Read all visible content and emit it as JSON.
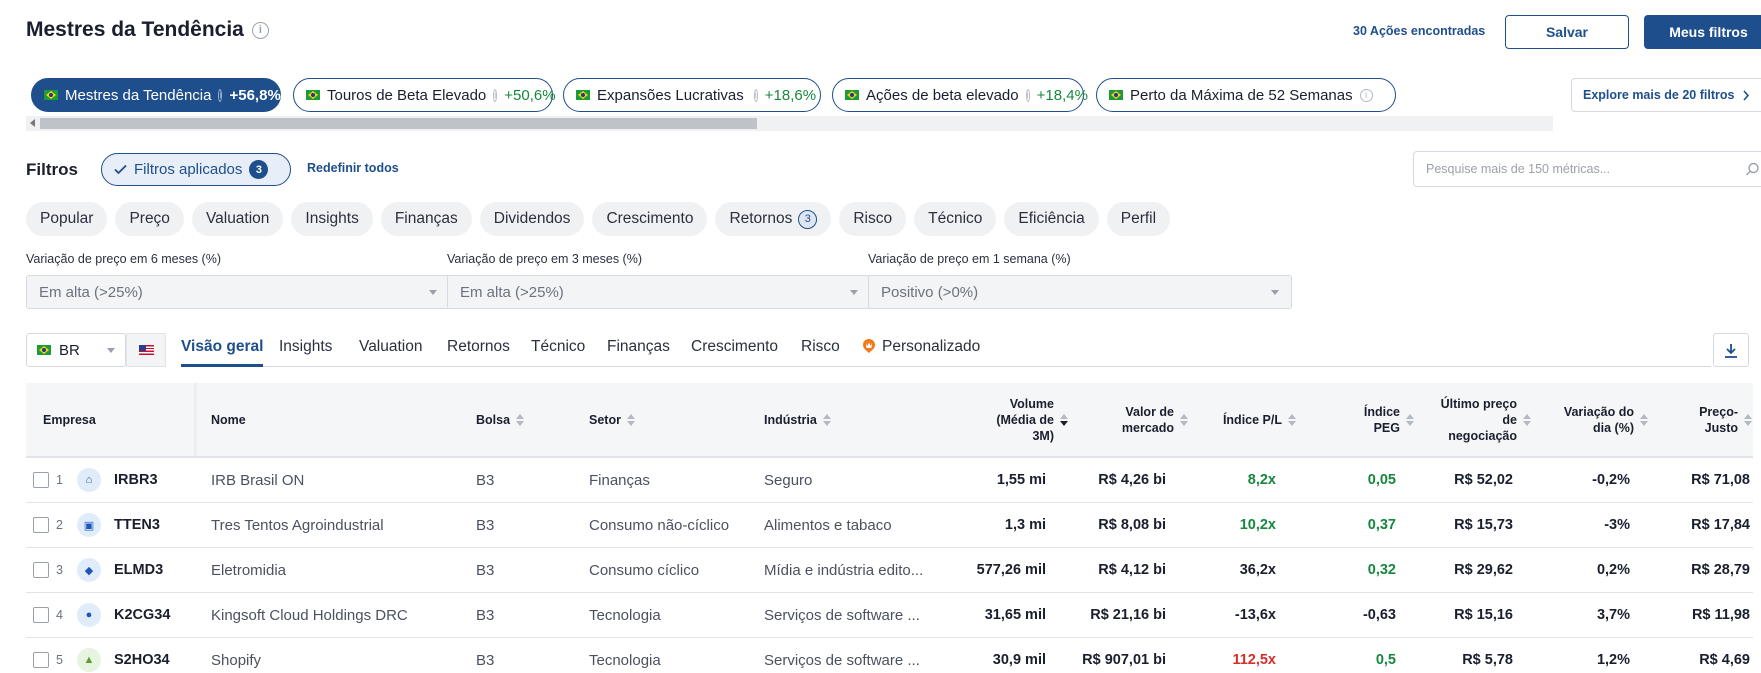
{
  "header": {
    "title": "Mestres da Tendência",
    "found": "30 Ações encontradas",
    "save_label": "Salvar",
    "my_filters_label": "Meus filtros"
  },
  "presets": [
    {
      "label": "Mestres da Tendência",
      "pct": "+56,8%"
    },
    {
      "label": "Touros de Beta Elevado",
      "pct": "+50,6%"
    },
    {
      "label": "Expansões Lucrativas",
      "pct": "+18,6%"
    },
    {
      "label": "Ações de beta elevado",
      "pct": "+18,4%"
    },
    {
      "label": "Perto da Máxima de 52 Semanas",
      "pct": ""
    }
  ],
  "explore_label": "Explore mais de 20 filtros",
  "filters": {
    "label": "Filtros",
    "applied_label": "Filtros aplicados",
    "applied_count": "3",
    "reset_label": "Redefinir todos",
    "search_placeholder": "Pesquise mais de 150 métricas..."
  },
  "categories": [
    "Popular",
    "Preço",
    "Valuation",
    "Insights",
    "Finanças",
    "Dividendos",
    "Crescimento",
    "Retornos",
    "Risco",
    "Técnico",
    "Eficiência",
    "Perfil"
  ],
  "categories_badge": {
    "retornos": "3"
  },
  "dropdowns": [
    {
      "label": "Variação de preço em 6 meses (%)",
      "value": "Em alta (>25%)"
    },
    {
      "label": "Variação de preço em 3 meses (%)",
      "value": "Em alta (>25%)"
    },
    {
      "label": "Variação de preço em 1 semana (%)",
      "value": "Positivo (>0%)"
    }
  ],
  "market": {
    "selected": "BR"
  },
  "tabs": [
    "Visão geral",
    "Insights",
    "Valuation",
    "Retornos",
    "Técnico",
    "Finanças",
    "Crescimento",
    "Risco",
    "Personalizado"
  ],
  "table": {
    "columns": {
      "empresa": "Empresa",
      "nome": "Nome",
      "bolsa": "Bolsa",
      "setor": "Setor",
      "industria": "Indústria",
      "volume": "Volume (Média de 3M)",
      "valor": "Valor de mercado",
      "pl": "Índice P/L",
      "peg": "Índice PEG",
      "ultimo": "Último preço de negociação",
      "variacao": "Variação do dia (%)",
      "justo": "Preço-Justo"
    },
    "rows": [
      {
        "rank": "1",
        "ticker": "IRBR3",
        "name": "IRB Brasil ON",
        "exchange": "B3",
        "sector": "Finanças",
        "industry": "Seguro",
        "volume": "1,55 mi",
        "mcap": "R$ 4,26 bi",
        "pe": "8,2x",
        "peg": "0,05",
        "last": "R$ 52,02",
        "change": "-0,2%",
        "fair": "R$ 71,08"
      },
      {
        "rank": "2",
        "ticker": "TTEN3",
        "name": "Tres Tentos Agroindustrial",
        "exchange": "B3",
        "sector": "Consumo não-cíclico",
        "industry": "Alimentos e tabaco",
        "volume": "1,3 mi",
        "mcap": "R$ 8,08 bi",
        "pe": "10,2x",
        "peg": "0,37",
        "last": "R$ 15,73",
        "change": "-3%",
        "fair": "R$ 17,84"
      },
      {
        "rank": "3",
        "ticker": "ELMD3",
        "name": "Eletromidia",
        "exchange": "B3",
        "sector": "Consumo cíclico",
        "industry": "Mídia e indústria edito...",
        "volume": "577,26 mil",
        "mcap": "R$ 4,12 bi",
        "pe": "36,2x",
        "peg": "0,32",
        "last": "R$ 29,62",
        "change": "0,2%",
        "fair": "R$ 28,79"
      },
      {
        "rank": "4",
        "ticker": "K2CG34",
        "name": "Kingsoft Cloud Holdings DRC",
        "exchange": "B3",
        "sector": "Tecnologia",
        "industry": "Serviços de software ...",
        "volume": "31,65 mil",
        "mcap": "R$ 21,16 bi",
        "pe": "-13,6x",
        "peg": "-0,63",
        "last": "R$ 15,16",
        "change": "3,7%",
        "fair": "R$ 11,98"
      },
      {
        "rank": "5",
        "ticker": "S2HO34",
        "name": "Shopify",
        "exchange": "B3",
        "sector": "Tecnologia",
        "industry": "Serviços de software ...",
        "volume": "30,9 mil",
        "mcap": "R$ 907,01 bi",
        "pe": "112,5x",
        "peg": "0,5",
        "last": "R$ 5,78",
        "change": "1,2%",
        "fair": "R$ 4,69"
      }
    ]
  },
  "colors": {
    "brand": "#1e4f8c",
    "positive": "#17873d",
    "negative": "#d62d2d"
  }
}
